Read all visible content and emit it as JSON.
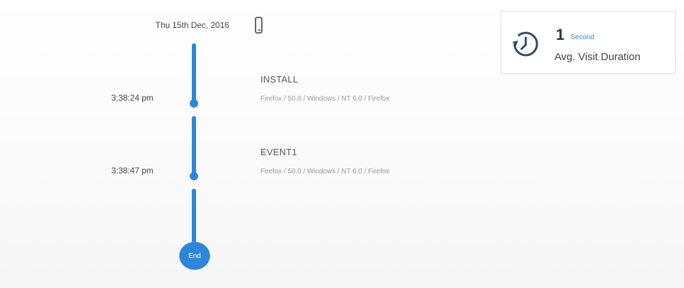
{
  "session": {
    "date": "Thu 15th Dec, 2016",
    "device_icon": "mobile-phone-icon"
  },
  "events": [
    {
      "time": "3:38:24 pm",
      "title": "INSTALL",
      "meta": "Firefox / 50.0 / Windows / NT 6.0 / Firefox"
    },
    {
      "time": "3:38:47 pm",
      "title": "EVENT1",
      "meta": "Firefox / 50.0 / Windows / NT 6.0 / Firefox"
    }
  ],
  "timeline_end": {
    "label": "End"
  },
  "avg_visit": {
    "icon": "clock-icon",
    "value": "1",
    "unit": "Second",
    "label": "Avg. Visit Duration"
  },
  "colors": {
    "accent": "#2d86d9",
    "text": "#333333",
    "muted": "#999999"
  }
}
